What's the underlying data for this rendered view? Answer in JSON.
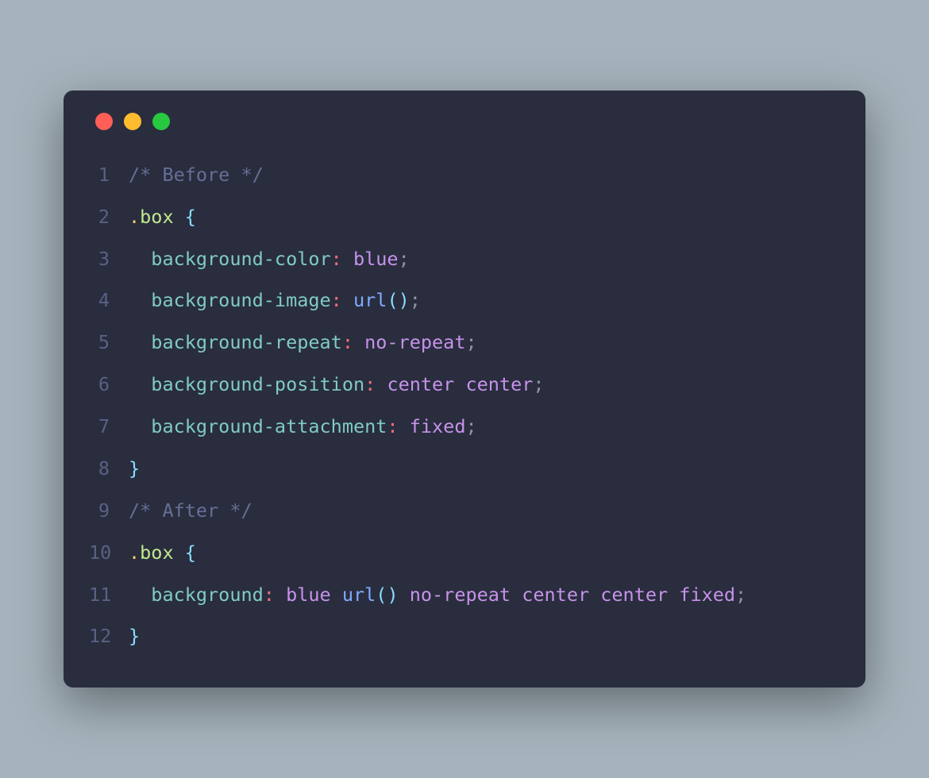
{
  "code": {
    "lines": [
      {
        "num": "1",
        "tokens": [
          {
            "t": "/* Before */",
            "c": "tok-comment"
          }
        ]
      },
      {
        "num": "2",
        "tokens": [
          {
            "t": ".",
            "c": "tok-sel"
          },
          {
            "t": "box",
            "c": "tok-class"
          },
          {
            "t": " ",
            "c": ""
          },
          {
            "t": "{",
            "c": "tok-brace"
          }
        ]
      },
      {
        "num": "3",
        "tokens": [
          {
            "t": "  ",
            "c": ""
          },
          {
            "t": "background-color",
            "c": "tok-prop"
          },
          {
            "t": ":",
            "c": "tok-colon"
          },
          {
            "t": " ",
            "c": ""
          },
          {
            "t": "blue",
            "c": "tok-value"
          },
          {
            "t": ";",
            "c": "tok-punct"
          }
        ]
      },
      {
        "num": "4",
        "tokens": [
          {
            "t": "  ",
            "c": ""
          },
          {
            "t": "background-image",
            "c": "tok-prop"
          },
          {
            "t": ":",
            "c": "tok-colon"
          },
          {
            "t": " ",
            "c": ""
          },
          {
            "t": "url",
            "c": "tok-func"
          },
          {
            "t": "()",
            "c": "tok-brace"
          },
          {
            "t": ";",
            "c": "tok-punct"
          }
        ]
      },
      {
        "num": "5",
        "tokens": [
          {
            "t": "  ",
            "c": ""
          },
          {
            "t": "background-repeat",
            "c": "tok-prop"
          },
          {
            "t": ":",
            "c": "tok-colon"
          },
          {
            "t": " ",
            "c": ""
          },
          {
            "t": "no-repeat",
            "c": "tok-value"
          },
          {
            "t": ";",
            "c": "tok-punct"
          }
        ]
      },
      {
        "num": "6",
        "tokens": [
          {
            "t": "  ",
            "c": ""
          },
          {
            "t": "background-position",
            "c": "tok-prop"
          },
          {
            "t": ":",
            "c": "tok-colon"
          },
          {
            "t": " ",
            "c": ""
          },
          {
            "t": "center center",
            "c": "tok-value"
          },
          {
            "t": ";",
            "c": "tok-punct"
          }
        ]
      },
      {
        "num": "7",
        "tokens": [
          {
            "t": "  ",
            "c": ""
          },
          {
            "t": "background-attachment",
            "c": "tok-prop"
          },
          {
            "t": ":",
            "c": "tok-colon"
          },
          {
            "t": " ",
            "c": ""
          },
          {
            "t": "fixed",
            "c": "tok-value"
          },
          {
            "t": ";",
            "c": "tok-punct"
          }
        ]
      },
      {
        "num": "8",
        "tokens": [
          {
            "t": "}",
            "c": "tok-brace"
          }
        ]
      },
      {
        "num": "9",
        "tokens": [
          {
            "t": "/* After */",
            "c": "tok-comment"
          }
        ]
      },
      {
        "num": "10",
        "tokens": [
          {
            "t": ".",
            "c": "tok-sel"
          },
          {
            "t": "box",
            "c": "tok-class"
          },
          {
            "t": " ",
            "c": ""
          },
          {
            "t": "{",
            "c": "tok-brace"
          }
        ]
      },
      {
        "num": "11",
        "tokens": [
          {
            "t": "  ",
            "c": ""
          },
          {
            "t": "background",
            "c": "tok-prop"
          },
          {
            "t": ":",
            "c": "tok-colon"
          },
          {
            "t": " ",
            "c": ""
          },
          {
            "t": "blue ",
            "c": "tok-value"
          },
          {
            "t": "url",
            "c": "tok-func"
          },
          {
            "t": "()",
            "c": "tok-brace"
          },
          {
            "t": " no-repeat center center fixed",
            "c": "tok-value"
          },
          {
            "t": ";",
            "c": "tok-punct"
          }
        ]
      },
      {
        "num": "12",
        "tokens": [
          {
            "t": "}",
            "c": "tok-brace"
          }
        ]
      }
    ]
  }
}
